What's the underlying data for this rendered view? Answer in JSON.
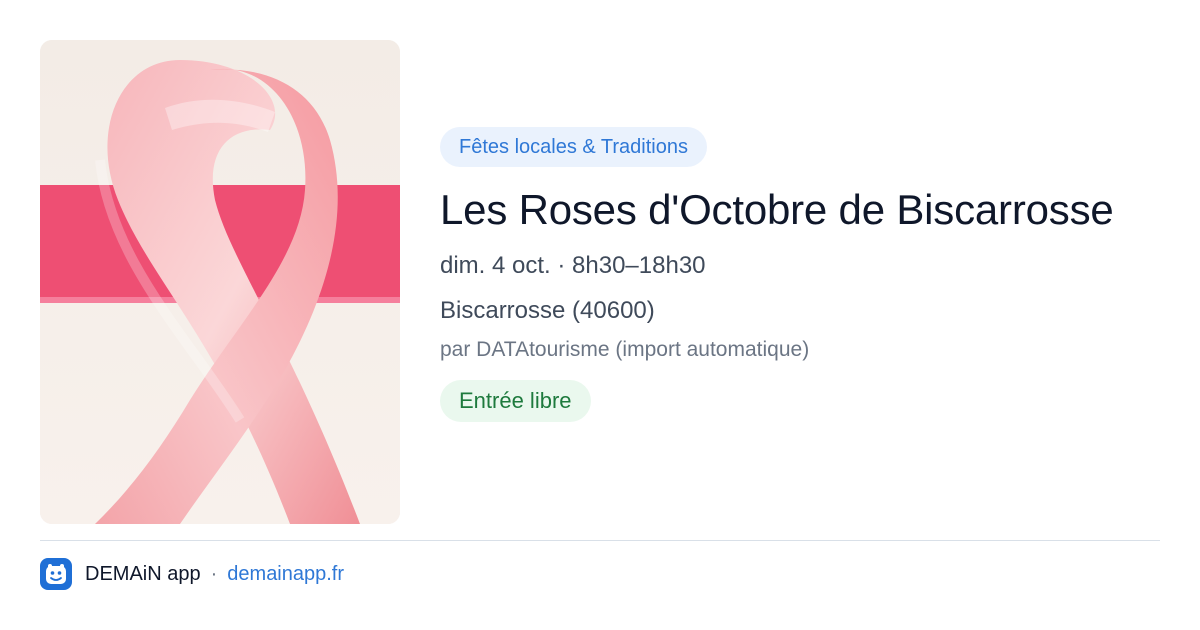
{
  "event": {
    "category": "Fêtes locales & Traditions",
    "title": "Les Roses d'Octobre de Biscarrosse",
    "date": "dim. 4 oct. · 8h30–18h30",
    "location": "Biscarrosse (40600)",
    "source": "par DATAtourisme (import automatique)",
    "price": "Entrée libre"
  },
  "footer": {
    "app_name": "DEMAiN app",
    "separator": "·",
    "link": "demainapp.fr"
  },
  "colors": {
    "accent_blue": "#2f78d6",
    "category_bg": "#eaf2fd",
    "price_green": "#1e7a3d",
    "price_bg": "#eaf8ee",
    "ribbon_pink": "#f4a3a8",
    "band_pink": "#ee4f73"
  },
  "icons": {
    "app_logo": "app-logo-icon",
    "image": "pink-ribbon-photo"
  }
}
